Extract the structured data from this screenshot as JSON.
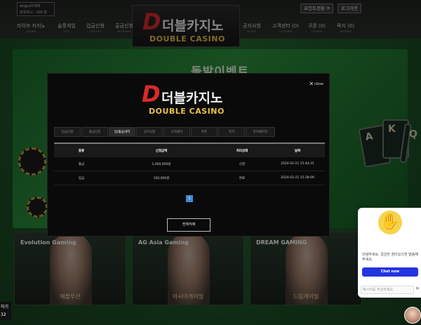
{
  "user": {
    "username": "wngud7285",
    "points_line": "보유머니 : 100 원"
  },
  "logo": {
    "letter": "D",
    "korean": "더블카지노",
    "english": "DOUBLE CASINO"
  },
  "header_buttons": {
    "point_convert": "포인트전환 ⟳",
    "logout": "로그아웃"
  },
  "nav": [
    {
      "label": "라이브 카지노",
      "sub": "CASINO"
    },
    {
      "label": "슬롯게임",
      "sub": "SLOT"
    },
    {
      "label": "입금신청",
      "sub": "DEPOSIT"
    },
    {
      "label": "출금신청",
      "sub": "WITHDRAW"
    },
    {
      "label": "공지사항",
      "sub": "NOTICE"
    },
    {
      "label": "고객센터 (0)",
      "sub": "CUSTOMER"
    },
    {
      "label": "쿠폰 (0)",
      "sub": "COUPON"
    },
    {
      "label": "쪽지 (0)",
      "sub": "MESSAGE"
    }
  ],
  "banner": {
    "title": "돌발이벤트",
    "cards": [
      "A",
      "K",
      "Q"
    ]
  },
  "games": [
    {
      "brand": "Evolution Gaming",
      "caption": "에볼루션"
    },
    {
      "brand": "AG Asia Gaming",
      "caption": "아시아게이밍"
    },
    {
      "brand": "DREAM GAMING",
      "caption": "드림게이밍"
    }
  ],
  "modal": {
    "close_label": "close",
    "tabs": [
      "입금신청",
      "출금신청",
      "입/출금내역",
      "공지사항",
      "고객센터",
      "쿠폰",
      "쪽지",
      "마이페이지"
    ],
    "active_tab": 2,
    "table": {
      "headers": [
        "종류",
        "신청금액",
        "처리상태",
        "날짜"
      ],
      "rows": [
        [
          "출금",
          "1,000,000원",
          "신청",
          "2024-02-21 15:44:31"
        ],
        [
          "입금",
          "100,000원",
          "완료",
          "2024-02-21 15:38:09"
        ]
      ]
    },
    "page": "1",
    "delete_all": "전체삭제"
  },
  "chat": {
    "message": "안녕하세요. 궁금한 점이있으면 말씀해주세요.",
    "button": "Chat now",
    "input_placeholder": "메시지를 작성하세요.",
    "send_icon": "➤"
  },
  "bottom_left": {
    "line1": "하기",
    "line2": "32"
  }
}
